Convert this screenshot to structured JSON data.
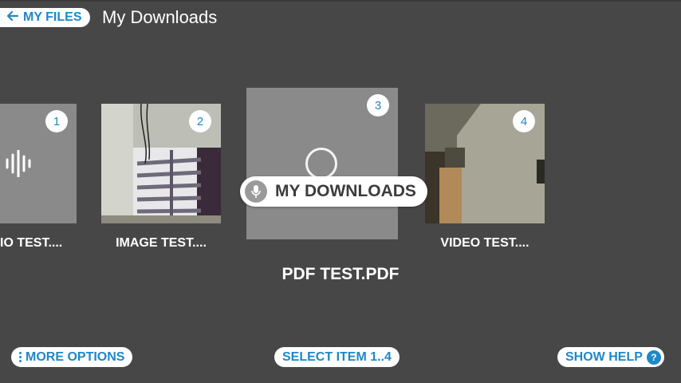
{
  "header": {
    "back_label": "MY FILES",
    "title": "My Downloads"
  },
  "tiles": [
    {
      "number": "1",
      "caption": "IO TEST....",
      "icon": "audio-waveform-icon"
    },
    {
      "number": "2",
      "caption": "IMAGE TEST....",
      "icon": "image-thumbnail"
    },
    {
      "number": "3",
      "caption": "PDF TEST.PDF",
      "icon": "loading-spinner-icon"
    },
    {
      "number": "4",
      "caption": "VIDEO TEST....",
      "icon": "video-thumbnail"
    }
  ],
  "voice_overlay": {
    "label": "MY DOWNLOADS",
    "icon": "microphone-icon"
  },
  "bottom": {
    "more_options": "MORE OPTIONS",
    "select_item": "SELECT ITEM 1..4",
    "show_help": "SHOW HELP",
    "help_glyph": "?"
  },
  "colors": {
    "background": "#474747",
    "accent": "#1e88c8",
    "tile": "#8a8a8a"
  }
}
